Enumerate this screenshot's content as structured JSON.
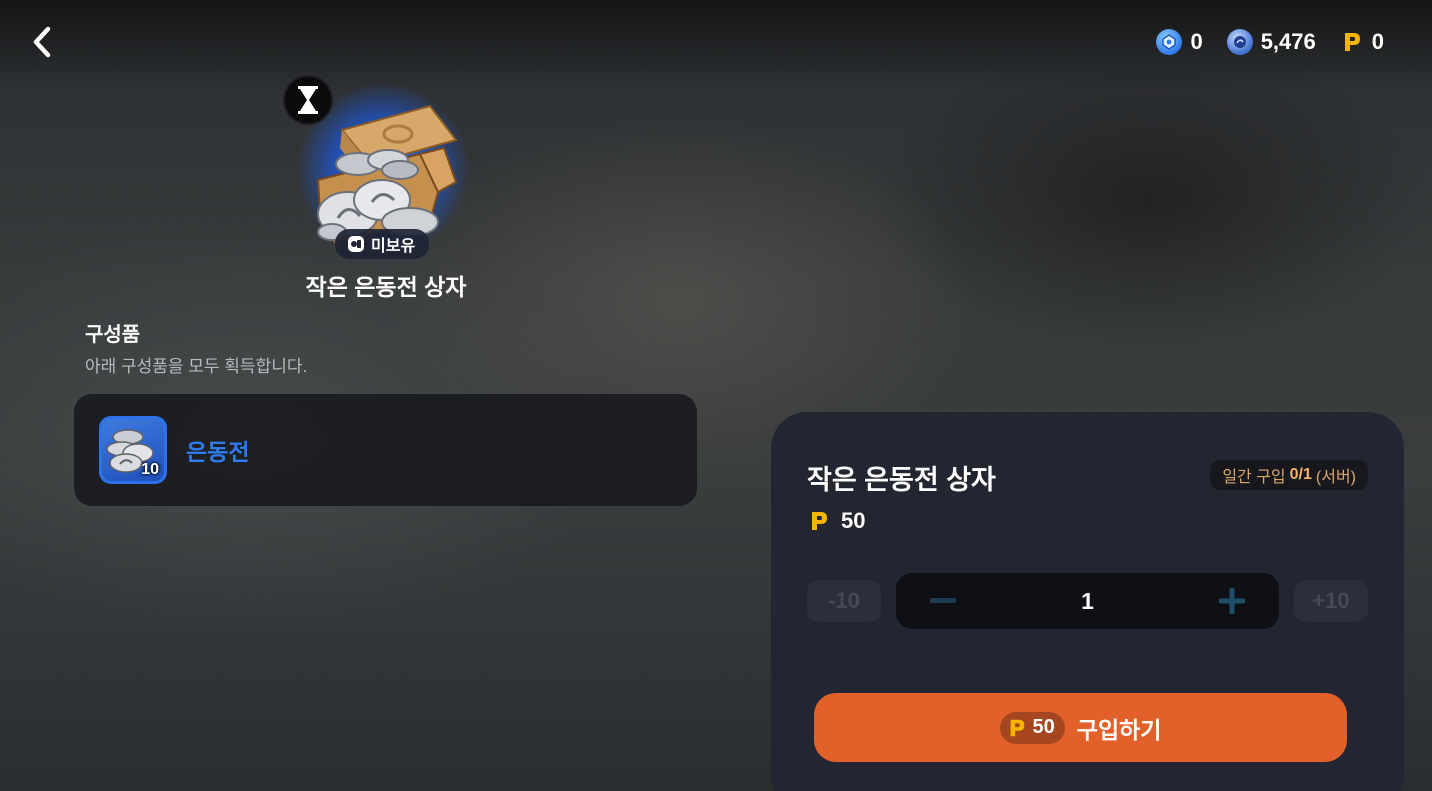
{
  "header": {
    "back_icon": "chevron-left-icon",
    "currencies": [
      {
        "icon": "blue-gem-coin-icon",
        "value": "0",
        "color": "#3d8cf0"
      },
      {
        "icon": "silver-blue-coin-icon",
        "value": "5,476",
        "color": "#4a7fd6"
      },
      {
        "icon": "gold-p-icon",
        "value": "0",
        "color": "#f4b400"
      }
    ]
  },
  "product": {
    "timer_icon": "hourglass-icon",
    "owned_badge": "미보유",
    "title": "작은 은동전 상자"
  },
  "contents": {
    "title": "구성품",
    "subtitle": "아래 구성품을 모두 획득합니다.",
    "items": [
      {
        "name": "은동전",
        "count": "10",
        "icon": "silver-coin-stack-icon"
      }
    ]
  },
  "purchase": {
    "title": "작은 은동전 상자",
    "limit_prefix": "일간 구입",
    "limit_value": "0/1",
    "limit_suffix": "(서버)",
    "price": "50",
    "minus10_label": "-10",
    "plus10_label": "+10",
    "quantity": "1",
    "buy_price": "50",
    "buy_label": "구입하기",
    "accent_color": "#e2602a"
  }
}
